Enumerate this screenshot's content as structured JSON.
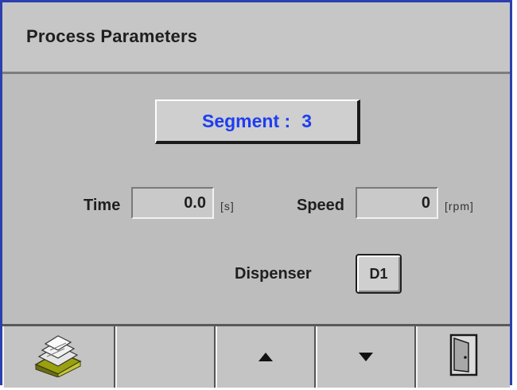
{
  "header": {
    "title": "Process Parameters"
  },
  "segment": {
    "label": "Segment :",
    "value": "3"
  },
  "time": {
    "label": "Time",
    "value": "0.0",
    "unit": "[s]"
  },
  "speed": {
    "label": "Speed",
    "value": "0",
    "unit": "[rpm]"
  },
  "dispenser": {
    "label": "Dispenser",
    "button_label": "D1"
  },
  "toolbar": {
    "buttons": [
      {
        "icon": "disk-stack-icon"
      },
      {
        "icon": ""
      },
      {
        "icon": "arrow-up-icon"
      },
      {
        "icon": "arrow-down-icon"
      },
      {
        "icon": "exit-door-icon"
      }
    ]
  },
  "colors": {
    "accent_blue": "#1e3ef0",
    "frame_blue": "#2b3fae",
    "panel_gray": "#bdbdbd"
  }
}
